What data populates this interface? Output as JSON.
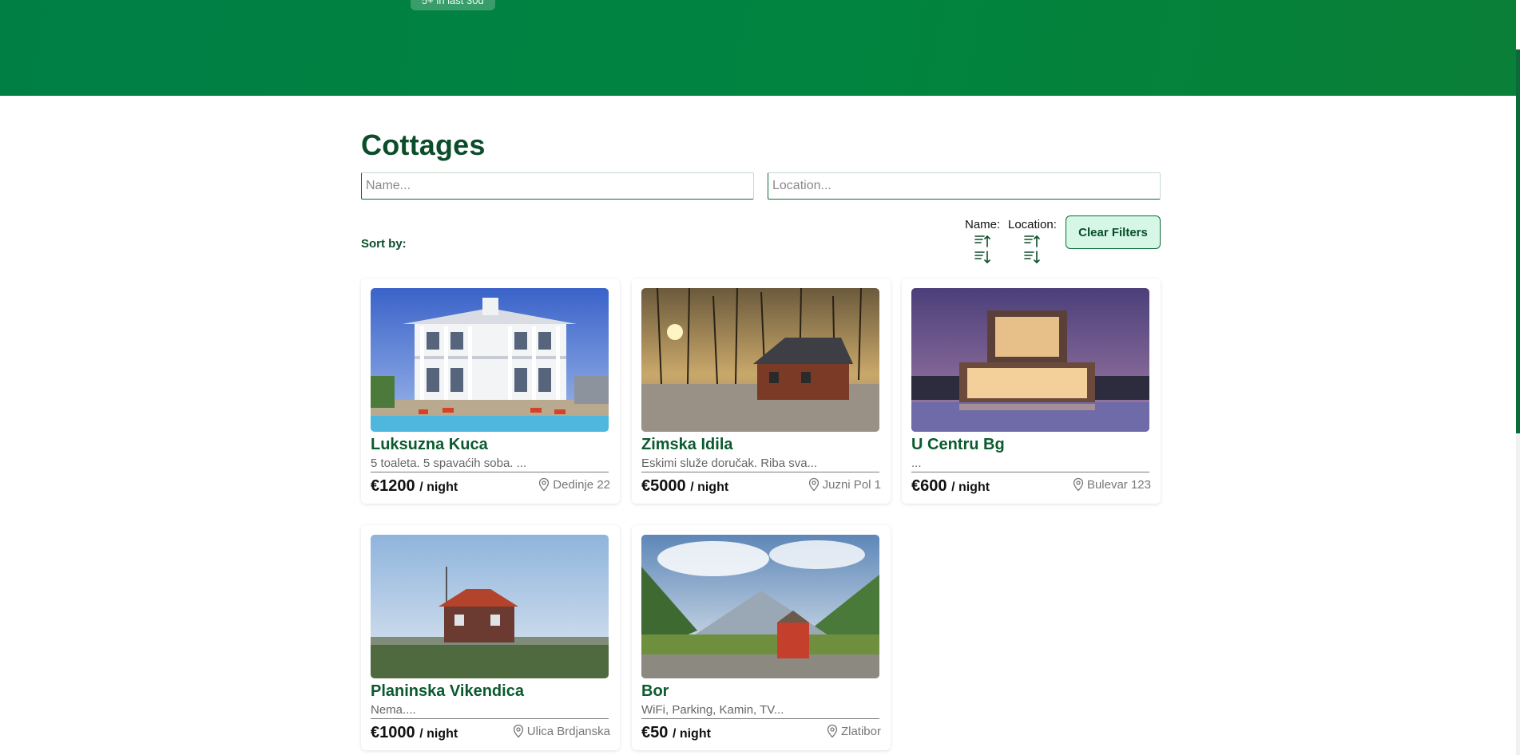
{
  "hero": {
    "badge": "5+ in last 30d"
  },
  "page": {
    "title": "Cottages"
  },
  "filters": {
    "name_placeholder": "Name...",
    "location_placeholder": "Location..."
  },
  "sort": {
    "label": "Sort by:",
    "name_label": "Name:",
    "location_label": "Location:"
  },
  "clear_filters_label": "Clear Filters",
  "cards": [
    {
      "title": "Luksuzna Kuca",
      "description": "5 toaleta. 5 spavaćih soba. ...",
      "price": "€1200",
      "unit": "/ night",
      "location": "Dedinje 22"
    },
    {
      "title": "Zimska Idila",
      "description": "Eskimi služe doručak. Riba sva...",
      "price": "€5000",
      "unit": "/ night",
      "location": "Juzni Pol 1"
    },
    {
      "title": "U Centru Bg",
      "description": "...",
      "price": "€600",
      "unit": "/ night",
      "location": "Bulevar 123"
    },
    {
      "title": "Planinska Vikendica",
      "description": "Nema....",
      "price": "€1000",
      "unit": "/ night",
      "location": "Ulica Brdjanska"
    },
    {
      "title": "Bor",
      "description": "WiFi, Parking, Kamin, TV...",
      "price": "€50",
      "unit": "/ night",
      "location": "Zlatibor"
    }
  ],
  "colors": {
    "brand_green": "#007f45",
    "heading_green": "#0b4d2a",
    "button_bg": "#d6f7e6"
  }
}
